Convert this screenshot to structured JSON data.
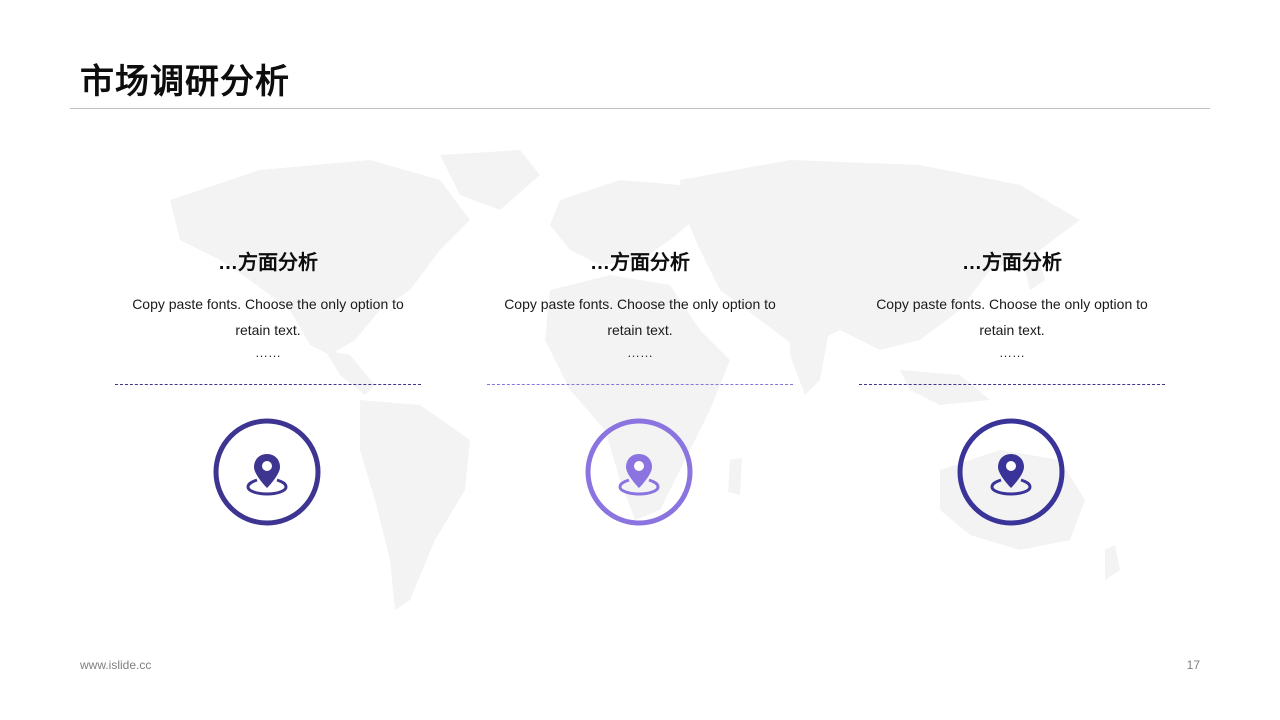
{
  "title": "市场调研分析",
  "columns": [
    {
      "heading": "…方面分析",
      "body": "Copy paste fonts. Choose the only option to retain text.",
      "ellipsis": "……",
      "icon": "location-pin-icon",
      "color": "#3e3591"
    },
    {
      "heading": "…方面分析",
      "body": "Copy paste fonts. Choose the only option to retain text.",
      "ellipsis": "……",
      "icon": "location-pin-icon",
      "color": "#8b74e0"
    },
    {
      "heading": "…方面分析",
      "body": "Copy paste fonts. Choose the only option to retain text.",
      "ellipsis": "……",
      "icon": "location-pin-icon",
      "color": "#3a3499"
    }
  ],
  "footer": {
    "website": "www.islide.cc",
    "page_number": "17"
  },
  "colors": {
    "map": "#f2f2f2",
    "rule": "#bfbfbf",
    "footer_text": "#7f7f7f"
  }
}
